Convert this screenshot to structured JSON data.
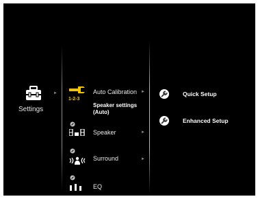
{
  "left": {
    "settings_label": "Settings",
    "toolbox_icon": "toolbox-icon"
  },
  "menu": {
    "items": [
      {
        "label": "Auto Calibration",
        "icon": "wrench-icon",
        "sub_icon": "1-2-3",
        "desc": "Speaker settings (Auto)"
      },
      {
        "label": "Speaker",
        "icon": "speaker-icon"
      },
      {
        "label": "Surround",
        "icon": "surround-icon"
      },
      {
        "label": "EQ",
        "icon": "eq-icon"
      }
    ],
    "arrow": "►"
  },
  "right": {
    "items": [
      {
        "label": "Quick Setup",
        "icon": "wrench-icon"
      },
      {
        "label": "Enhanced Setup",
        "icon": "wrench-icon"
      }
    ]
  },
  "colors": {
    "background": "#000000",
    "accent": "#f5c400",
    "text": "#ffffff"
  }
}
